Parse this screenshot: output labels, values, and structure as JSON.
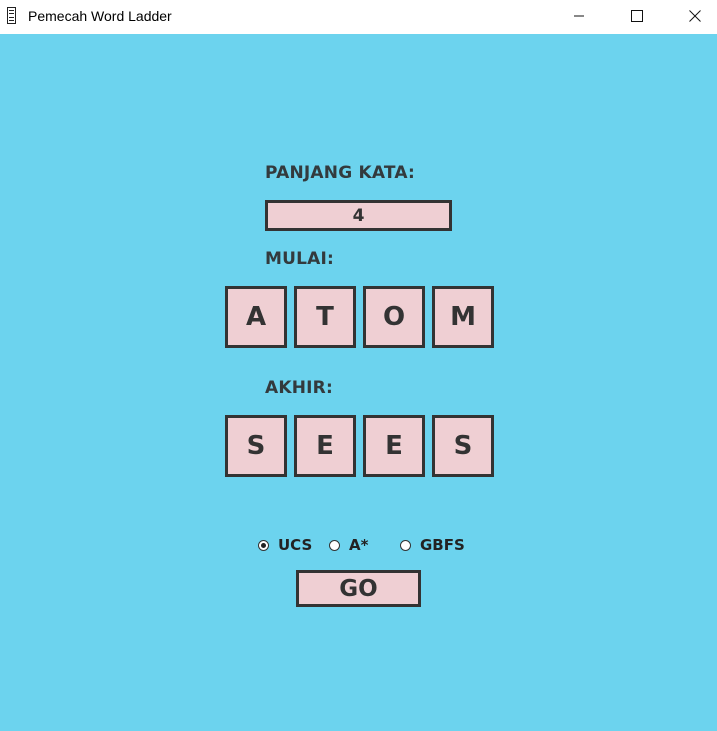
{
  "window": {
    "title": "Pemecah Word Ladder",
    "controls": [
      "minimize-icon",
      "maximize-icon",
      "close-icon"
    ]
  },
  "colors": {
    "background": "#6cd3ee",
    "tile": "#efcfd3",
    "border": "#333333",
    "text": "#333a3d"
  },
  "word_length": {
    "label": "PANJANG KATA:",
    "value": "4"
  },
  "start": {
    "label": "MULAI:",
    "letters": [
      "A",
      "T",
      "O",
      "M"
    ]
  },
  "end": {
    "label": "AKHIR:",
    "letters": [
      "S",
      "E",
      "E",
      "S"
    ]
  },
  "algorithms": {
    "options": [
      "UCS",
      "A*",
      "GBFS"
    ],
    "selected": "UCS"
  },
  "go_button": {
    "label": "GO"
  }
}
